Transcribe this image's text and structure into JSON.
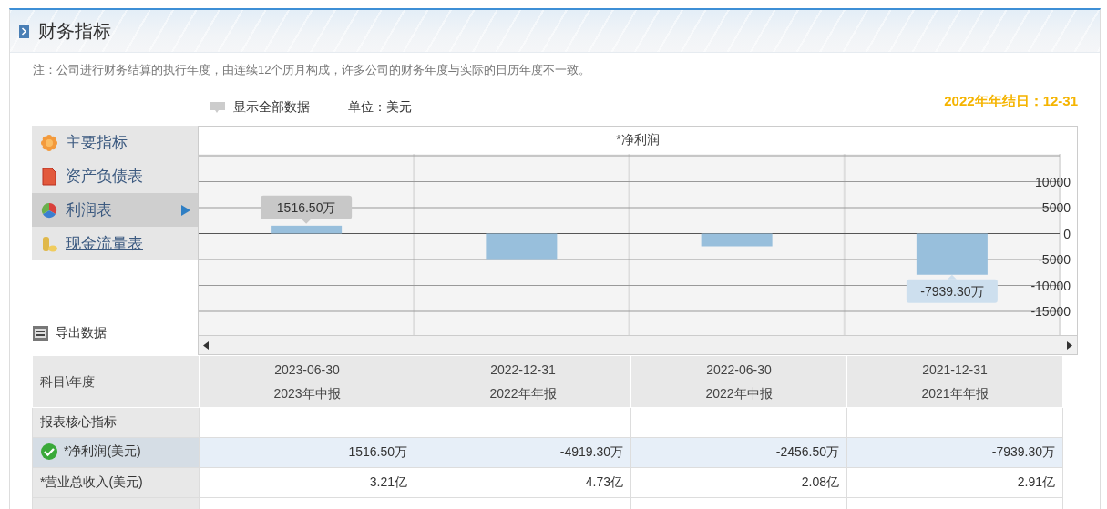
{
  "panel": {
    "title": "财务指标",
    "note": "注：公司进行财务结算的执行年度，由连续12个历月构成，许多公司的财务年度与实际的日历年度不一致。"
  },
  "toolbar": {
    "show_all": "显示全部数据",
    "unit": "单位：美元",
    "year_end": "2022年年结日：12-31"
  },
  "sidebar": {
    "items": [
      {
        "label": "主要指标",
        "selected": false,
        "hovered": false
      },
      {
        "label": "资产负债表",
        "selected": false,
        "hovered": false
      },
      {
        "label": "利润表",
        "selected": true,
        "hovered": false
      },
      {
        "label": "现金流量表",
        "selected": false,
        "hovered": true
      }
    ],
    "export": "导出数据"
  },
  "chart": {
    "chart_data": {
      "type": "bar",
      "title": "*净利润",
      "values": [
        1516.5,
        -4919.3,
        -2456.5,
        -7939.3
      ],
      "grid": true,
      "ylim": [
        -20000,
        15000
      ],
      "yticks": [
        10000,
        5000,
        0,
        -5000,
        -10000,
        -15000
      ],
      "value_labels": [
        "1516.50万",
        null,
        null,
        "-7939.30万"
      ]
    }
  },
  "table": {
    "corner": "科目\\年度",
    "columns": [
      {
        "date": "2023-06-30",
        "period": "2023年中报"
      },
      {
        "date": "2022-12-31",
        "period": "2022年年报"
      },
      {
        "date": "2022-06-30",
        "period": "2022年中报"
      },
      {
        "date": "2021-12-31",
        "period": "2021年年报"
      }
    ],
    "rows": [
      {
        "label": "报表核心指标",
        "selected": false,
        "cells": []
      },
      {
        "label": "*净利润(美元)",
        "selected": true,
        "cells": [
          "1516.50万",
          "-4919.30万",
          "-2456.50万",
          "-7939.30万"
        ]
      },
      {
        "label": "*营业总收入(美元)",
        "selected": false,
        "cells": [
          "3.21亿",
          "4.73亿",
          "2.08亿",
          "2.91亿"
        ]
      },
      {
        "label": "",
        "selected": false,
        "cells": []
      }
    ]
  }
}
